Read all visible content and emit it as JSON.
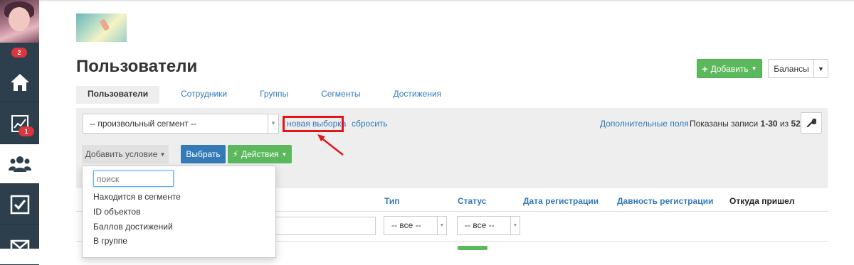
{
  "sidebar": {
    "avatar_badge": "2",
    "items": [
      {
        "name": "home",
        "icon": "home-icon",
        "badge": ""
      },
      {
        "name": "analytics",
        "icon": "chart-icon",
        "badge": "1"
      },
      {
        "name": "users",
        "icon": "users-icon",
        "badge": ""
      },
      {
        "name": "tasks",
        "icon": "checkbox-icon",
        "badge": ""
      },
      {
        "name": "messages",
        "icon": "envelope-icon",
        "badge": ""
      }
    ]
  },
  "header": {
    "title": "Пользователи",
    "add_button": "Добавить",
    "balances_button": "Балансы"
  },
  "tabs": [
    {
      "label": "Пользователи",
      "active": true
    },
    {
      "label": "Сотрудники",
      "active": false
    },
    {
      "label": "Группы",
      "active": false
    },
    {
      "label": "Сегменты",
      "active": false
    },
    {
      "label": "Достижения",
      "active": false
    }
  ],
  "filter": {
    "segment_select": "-- произвольный сегмент --",
    "new_selection": "новая выборка",
    "reset": "сбросить",
    "extra_fields": "Дополнительные поля",
    "records_prefix": "Показаны записи ",
    "records_range": "1-30",
    "records_of": " из ",
    "records_total": "52",
    "records_suffix": ".",
    "add_condition": "Добавить условие",
    "choose": "Выбрать",
    "actions": "Действия"
  },
  "dropdown": {
    "search_placeholder": "поиск",
    "items": [
      "Находится в сегменте",
      "ID объектов",
      "Баллов достижений",
      "В группе"
    ]
  },
  "table": {
    "headers": {
      "type": "Тип",
      "status": "Статус",
      "registered": "Дата регистрации",
      "reg_age": "Давность регистрации",
      "source": "Откуда пришел"
    },
    "type_filter": "-- все --",
    "status_filter": "-- все --"
  },
  "colors": {
    "sidebar": "#2d3f4c",
    "primary": "#337ab7",
    "success": "#5cb85c",
    "danger": "#d9363e",
    "highlight": "#e0161b"
  }
}
